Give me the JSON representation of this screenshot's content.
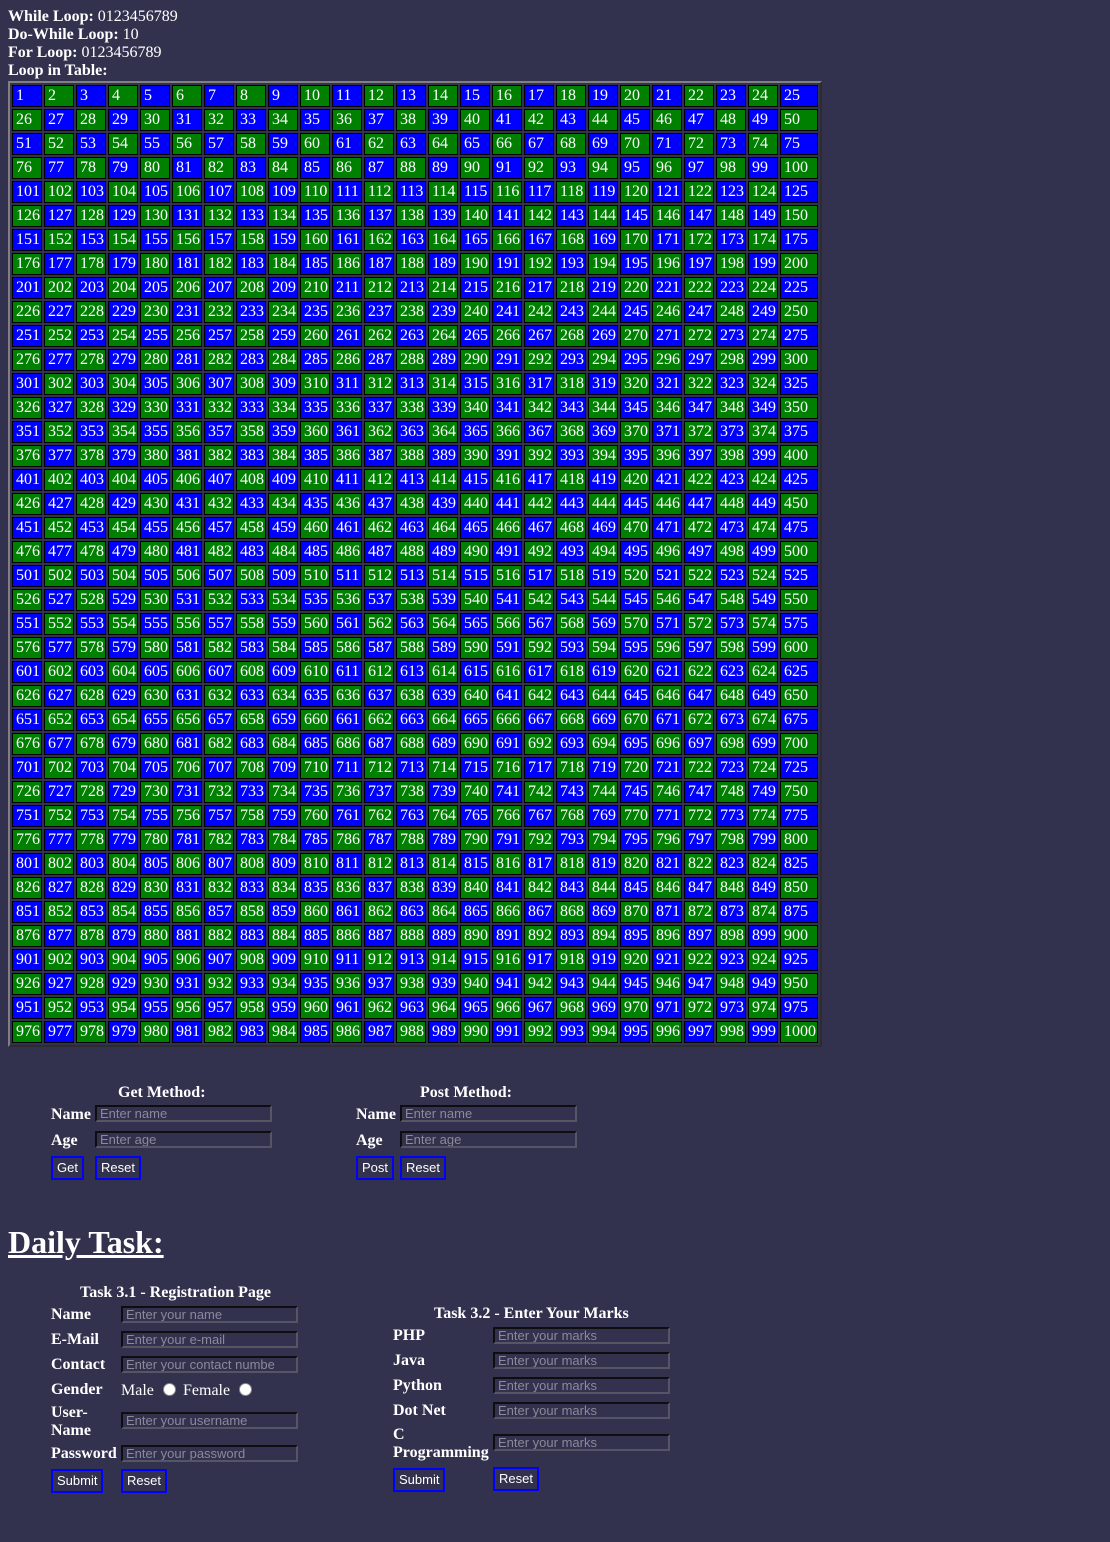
{
  "loops": {
    "while_label": "While Loop:",
    "while_value": " 0123456789",
    "dowhile_label": "Do-While Loop:",
    "dowhile_value": " 10",
    "for_label": "For Loop:",
    "for_value": " 0123456789",
    "table_label": "Loop in Table:"
  },
  "table": {
    "start": 1,
    "end": 1000,
    "columns": 25,
    "colors": {
      "odd_row_odd_cell": "#0000ff",
      "alt": "#008000"
    }
  },
  "get_form": {
    "title": "Get Method:",
    "name_label": "Name",
    "name_placeholder": "Enter name",
    "age_label": "Age",
    "age_placeholder": "Enter age",
    "submit": "Get",
    "reset": "Reset"
  },
  "post_form": {
    "title": "Post Method:",
    "name_label": "Name",
    "name_placeholder": "Enter name",
    "age_label": "Age",
    "age_placeholder": "Enter age",
    "submit": "Post",
    "reset": "Reset"
  },
  "daily_task": {
    "heading": "Daily Task:"
  },
  "registration": {
    "title": "Task 3.1 - Registration Page",
    "name_label": "Name",
    "name_placeholder": "Enter your name",
    "email_label": "E-Mail",
    "email_placeholder": "Enter your e-mail",
    "contact_label": "Contact",
    "contact_placeholder": "Enter your contact numbe",
    "gender_label": "Gender",
    "male": "Male",
    "female": "Female",
    "username_label_1": "User-",
    "username_label_2": "Name",
    "username_placeholder": "Enter your username",
    "password_label": "Password",
    "password_placeholder": "Enter your password",
    "submit": "Submit",
    "reset": "Reset"
  },
  "marks": {
    "title": "Task 3.2 - Enter Your Marks",
    "php": "PHP",
    "java": "Java",
    "python": "Python",
    "dotnet": "Dot Net",
    "c_label_1": "C",
    "c_label_2": "Programming",
    "placeholder": "Enter your marks",
    "submit": "Submit",
    "reset": "Reset"
  }
}
